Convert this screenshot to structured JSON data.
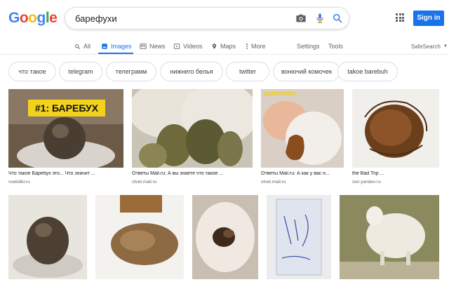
{
  "logo": [
    "G",
    "o",
    "o",
    "g",
    "l",
    "e"
  ],
  "logo_colors": [
    "#4285f4",
    "#ea4335",
    "#fbbc05",
    "#4285f4",
    "#34a853",
    "#ea4335"
  ],
  "search": {
    "query": "барефухи"
  },
  "header": {
    "sign_in": "Sign in",
    "safesearch": "SafeSearch"
  },
  "tabs": [
    {
      "label": "All",
      "icon": "search-icon"
    },
    {
      "label": "Images",
      "icon": "image-icon"
    },
    {
      "label": "News",
      "icon": "news-icon"
    },
    {
      "label": "Videos",
      "icon": "video-icon"
    },
    {
      "label": "Maps",
      "icon": "map-pin-icon"
    },
    {
      "label": "More",
      "icon": "kebab-icon"
    },
    {
      "label": "Settings"
    },
    {
      "label": "Tools"
    }
  ],
  "chips": [
    "что такое",
    "telegram",
    "телеграмм",
    "нижнего белья",
    "twitter",
    "вонючий комочек",
    "takoe barebuh"
  ],
  "results_row1": [
    {
      "caption": "Что такое Баребух это... Что значит ...",
      "source": "vsekidki.ru",
      "overlay": "#1: БАРЕБУХ"
    },
    {
      "caption": "Ответы Mail.ru: А вы знаете что такое ...",
      "source": "otvet.mail.ru"
    },
    {
      "caption": "Ответы Mail.ru: А как у вас н...",
      "source": "otvet.mail.ru",
      "overlay": "ЗДАРОВАЕМ"
    },
    {
      "caption": "the Bad Trip ...",
      "source": "zen.yandex.ru"
    }
  ],
  "results_row2": [
    {},
    {},
    {},
    {},
    {}
  ]
}
